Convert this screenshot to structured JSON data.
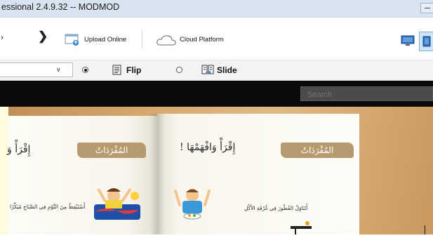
{
  "window": {
    "title": "essional 2.4.9.32 -- MODMOD"
  },
  "toolbar": {
    "upload_label": "Upload Online",
    "cloud_label": "Cloud Platform"
  },
  "viewbar": {
    "flip_label": "Flip",
    "slide_label": "Slide",
    "selected_mode": "Flip"
  },
  "search": {
    "placeholder": "Search"
  },
  "book": {
    "left_page": {
      "heading_partial": "إِقْرَأْ وَ",
      "banner": "المُفْرَدَاتُ",
      "caption": "أَسْتَيْقِظُ مِنَ النَّوْمِ فِي الصَّبَاحِ مُبَكِّرًا"
    },
    "right_page": {
      "heading": "إِقْرَأْ وَافْهَمْهَا !",
      "banner": "المُفْرَدَاتُ",
      "caption": "أَتَنَاوَلُ الفُطُورَ فِي غُرْفَةِ الأَكْلِ"
    }
  },
  "colors": {
    "title_bar": "#d9e4f1",
    "dark_bar": "#0a0a0a",
    "banner": "#b89a70"
  }
}
